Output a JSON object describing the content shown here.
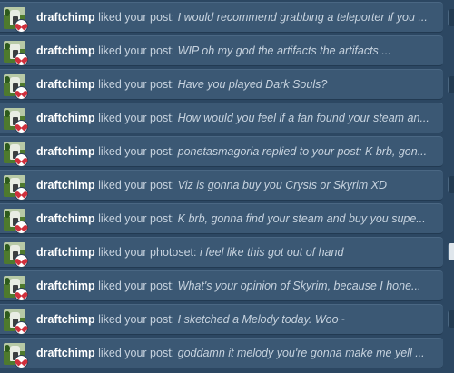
{
  "notifications": [
    {
      "user": "draftchimp",
      "action": "liked your post:",
      "quote": "I would recommend grabbing a teleporter if you ..."
    },
    {
      "user": "draftchimp",
      "action": "liked your post:",
      "quote": "WIP oh my god the artifacts the artifacts ..."
    },
    {
      "user": "draftchimp",
      "action": "liked your post:",
      "quote": "Have you played Dark Souls?"
    },
    {
      "user": "draftchimp",
      "action": "liked your post:",
      "quote": "How would you feel if a fan found your steam an..."
    },
    {
      "user": "draftchimp",
      "action": "liked your post:",
      "quote": "ponetasmagoria replied to your post: K brb, gon..."
    },
    {
      "user": "draftchimp",
      "action": "liked your post:",
      "quote": "Viz is gonna buy you Crysis or Skyrim XD"
    },
    {
      "user": "draftchimp",
      "action": "liked your post:",
      "quote": "K brb, gonna find your steam and buy you supe..."
    },
    {
      "user": "draftchimp",
      "action": "liked your photoset:",
      "quote": "i feel like this got out of hand"
    },
    {
      "user": "draftchimp",
      "action": "liked your post:",
      "quote": "What's your opinion of Skyrim, because I hone..."
    },
    {
      "user": "draftchimp",
      "action": "liked your post:",
      "quote": "I sketched a Melody today. Woo~"
    },
    {
      "user": "draftchimp",
      "action": "liked your post:",
      "quote": "goddamn it melody you're gonna make me yell ..."
    }
  ],
  "colors": {
    "background": "#2c4762",
    "row": "#3b5874",
    "username": "#ffffff",
    "text": "#c7d3df",
    "heart": "#d0303c"
  },
  "icons": {
    "avatar": "user-avatar",
    "badge": "heart-icon"
  }
}
